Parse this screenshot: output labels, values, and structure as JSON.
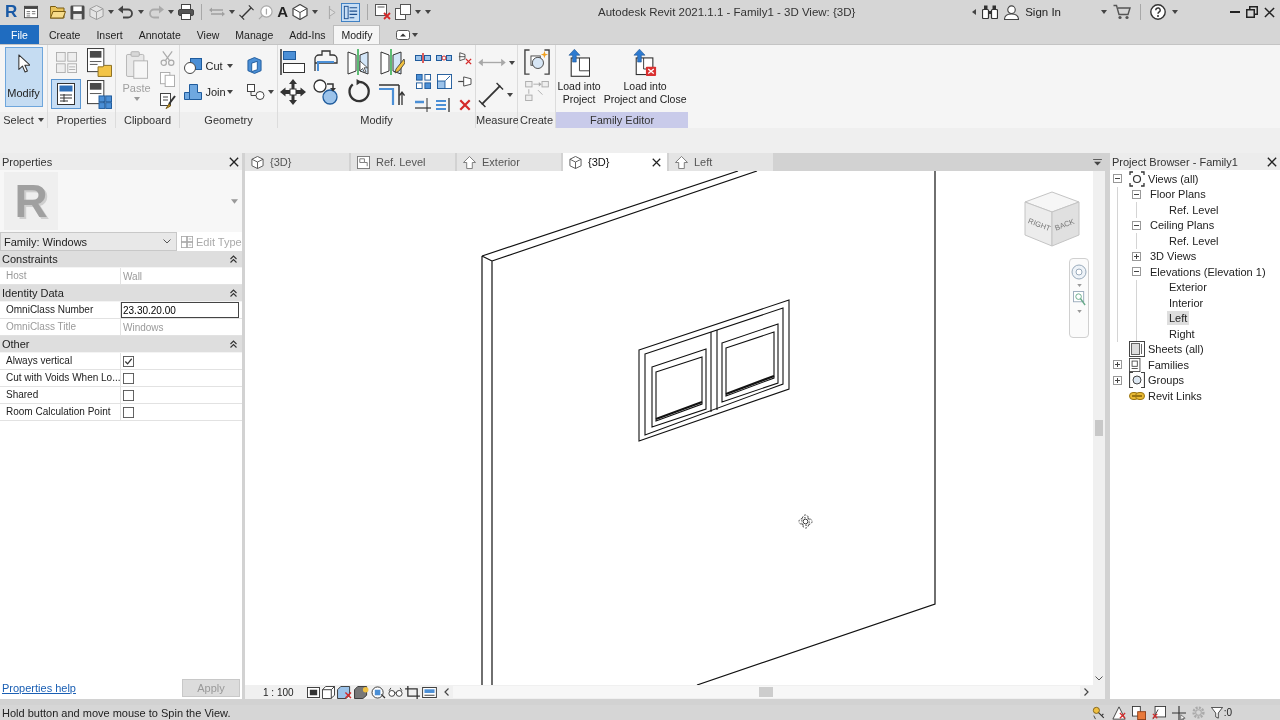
{
  "window": {
    "title": "Autodesk Revit 2021.1.1 - Family1 - 3D View: {3D}"
  },
  "quick_access": {
    "logo": "R",
    "text_tool": "A",
    "thin_lines_on": true
  },
  "account": {
    "sign_in": "Sign In"
  },
  "ribbon_tabs": [
    {
      "label": "File",
      "kind": "file",
      "selected": false
    },
    {
      "label": "Create",
      "kind": "tab",
      "selected": false
    },
    {
      "label": "Insert",
      "kind": "tab",
      "selected": false
    },
    {
      "label": "Annotate",
      "kind": "tab",
      "selected": false
    },
    {
      "label": "View",
      "kind": "tab",
      "selected": false
    },
    {
      "label": "Manage",
      "kind": "tab",
      "selected": false
    },
    {
      "label": "Add-Ins",
      "kind": "tab",
      "selected": false
    },
    {
      "label": "Modify",
      "kind": "tab",
      "selected": true
    }
  ],
  "ribbon_panels": [
    {
      "label": "Select",
      "kind": "select",
      "tools": [
        {
          "label": "Modify",
          "selected": true
        }
      ]
    },
    {
      "label": "Properties",
      "kind": "properties",
      "palette_on": true
    },
    {
      "label": "Clipboard",
      "kind": "clipboard",
      "tools": [
        {
          "label": "Paste",
          "disabled": true
        }
      ]
    },
    {
      "label": "Geometry",
      "kind": "geometry",
      "tools": [
        {
          "label": "Cut",
          "disabled": false
        },
        {
          "label": "Join",
          "disabled": false
        }
      ]
    },
    {
      "label": "Modify",
      "kind": "modify"
    },
    {
      "label": "Measure",
      "kind": "measure"
    },
    {
      "label": "Create",
      "kind": "create"
    },
    {
      "label": "Family Editor",
      "kind": "family_editor",
      "tools": [
        {
          "label": "Load into\nProject"
        },
        {
          "label": "Load into\nProject and Close"
        }
      ]
    }
  ],
  "properties": {
    "title": "Properties",
    "preview": "R",
    "type_selector": "Family: Windows",
    "edit_type": {
      "label": "Edit Type",
      "disabled": true
    },
    "groups": [
      {
        "name": "Constraints",
        "expanded": true,
        "rows": [
          {
            "kind": "text",
            "label": "Host",
            "value": "Wall",
            "disabled": true
          }
        ]
      },
      {
        "name": "Identity Data",
        "expanded": true,
        "rows": [
          {
            "kind": "field",
            "label": "OmniClass Number",
            "value": "23.30.20.00",
            "disabled": false
          },
          {
            "kind": "text",
            "label": "OmniClass Title",
            "value": "Windows",
            "disabled": true
          }
        ]
      },
      {
        "name": "Other",
        "expanded": true,
        "rows": [
          {
            "kind": "checkbox",
            "label": "Always vertical",
            "checked": true,
            "disabled": false
          },
          {
            "kind": "checkbox",
            "label": "Cut with Voids When Lo...",
            "checked": false,
            "disabled": false
          },
          {
            "kind": "checkbox",
            "label": "Shared",
            "checked": false,
            "disabled": false
          },
          {
            "kind": "checkbox",
            "label": "Room Calculation Point",
            "checked": false,
            "disabled": false
          }
        ]
      }
    ],
    "help_link": "Properties help",
    "apply": {
      "label": "Apply",
      "disabled": true
    }
  },
  "view_tabs": [
    {
      "label": "{3D}",
      "kind": "model",
      "selected": false
    },
    {
      "label": "Ref. Level",
      "kind": "plan",
      "selected": false
    },
    {
      "label": "Exterior",
      "kind": "elevation",
      "selected": false
    },
    {
      "label": "{3D}",
      "kind": "model",
      "selected": true
    },
    {
      "label": "Left",
      "kind": "elevation",
      "selected": false
    }
  ],
  "view": {
    "view_cube": [
      "RIGHT",
      "BACK"
    ],
    "scale": "1 : 100"
  },
  "project_browser": {
    "title": "Project Browser - Family1",
    "tree": [
      {
        "label": "Views (all)",
        "kind": "views",
        "expanded": true,
        "selected": false,
        "children": [
          {
            "label": "Floor Plans",
            "expanded": true,
            "selected": false,
            "children": [
              {
                "label": "Ref. Level",
                "selected": false
              }
            ]
          },
          {
            "label": "Ceiling Plans",
            "expanded": true,
            "selected": false,
            "children": [
              {
                "label": "Ref. Level",
                "selected": false
              }
            ]
          },
          {
            "label": "3D Views",
            "expanded": false,
            "selected": false
          },
          {
            "label": "Elevations (Elevation 1)",
            "expanded": true,
            "selected": false,
            "children": [
              {
                "label": "Exterior",
                "selected": false
              },
              {
                "label": "Interior",
                "selected": false
              },
              {
                "label": "Left",
                "selected": true
              },
              {
                "label": "Right",
                "selected": false
              }
            ]
          }
        ]
      },
      {
        "label": "Sheets (all)",
        "kind": "sheets",
        "selected": false
      },
      {
        "label": "Families",
        "kind": "families",
        "expanded": false,
        "selected": false
      },
      {
        "label": "Groups",
        "kind": "groups",
        "expanded": false,
        "selected": false
      },
      {
        "label": "Revit Links",
        "kind": "links",
        "selected": false
      }
    ]
  },
  "status_bar": {
    "message": "Hold button and move mouse to Spin the View.",
    "filter_count": ":0"
  }
}
